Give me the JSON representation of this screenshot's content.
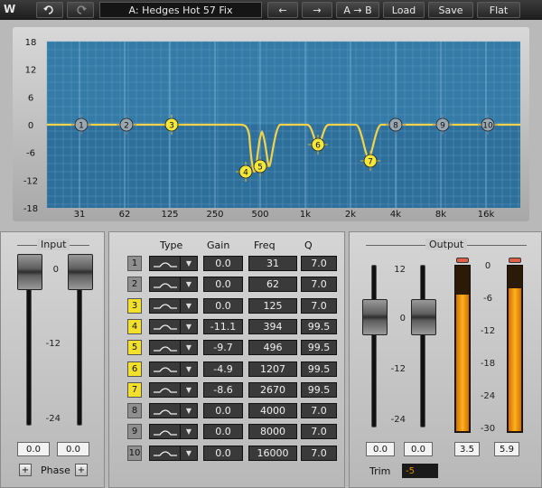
{
  "toolbar": {
    "undo_icon": "undo-icon",
    "redo_icon": "redo-icon",
    "preset_name": "A: Hedges Hot 57 Fix",
    "prev_icon": "arrow-left-icon",
    "next_icon": "arrow-right-icon",
    "ab_label": "A → B",
    "load_label": "Load",
    "save_label": "Save",
    "flat_label": "Flat"
  },
  "graph": {
    "y_labels": [
      "18",
      "12",
      "6",
      "0",
      "-6",
      "-12",
      "-18"
    ],
    "x_labels": [
      "31",
      "62",
      "125",
      "250",
      "500",
      "1k",
      "2k",
      "4k",
      "8k",
      "16k"
    ],
    "handles": [
      {
        "label": "1",
        "active": false
      },
      {
        "label": "2",
        "active": false
      },
      {
        "label": "3",
        "active": true
      },
      {
        "label": "4",
        "active": true
      },
      {
        "label": "5",
        "active": true
      },
      {
        "label": "6",
        "active": true
      },
      {
        "label": "7",
        "active": true
      },
      {
        "label": "8",
        "active": false
      },
      {
        "label": "9",
        "active": false
      },
      {
        "label": "10",
        "active": false
      }
    ],
    "curve_color": "#f2d34a",
    "bg_color": "#2e6e9a"
  },
  "input": {
    "title": "Input",
    "scale": [
      "0",
      "-12",
      "-24"
    ],
    "left_value": "0.0",
    "right_value": "0.0",
    "phase_label": "Phase",
    "plus_left": "+",
    "plus_right": "+"
  },
  "bands": {
    "headers": {
      "type": "Type",
      "gain": "Gain",
      "freq": "Freq",
      "q": "Q"
    },
    "rows": [
      {
        "num": "1",
        "on": false,
        "gain": "0.0",
        "freq": "31",
        "q": "7.0"
      },
      {
        "num": "2",
        "on": false,
        "gain": "0.0",
        "freq": "62",
        "q": "7.0"
      },
      {
        "num": "3",
        "on": true,
        "gain": "0.0",
        "freq": "125",
        "q": "7.0"
      },
      {
        "num": "4",
        "on": true,
        "gain": "-11.1",
        "freq": "394",
        "q": "99.5"
      },
      {
        "num": "5",
        "on": true,
        "gain": "-9.7",
        "freq": "496",
        "q": "99.5"
      },
      {
        "num": "6",
        "on": true,
        "gain": "-4.9",
        "freq": "1207",
        "q": "99.5"
      },
      {
        "num": "7",
        "on": true,
        "gain": "-8.6",
        "freq": "2670",
        "q": "99.5"
      },
      {
        "num": "8",
        "on": false,
        "gain": "0.0",
        "freq": "4000",
        "q": "7.0"
      },
      {
        "num": "9",
        "on": false,
        "gain": "0.0",
        "freq": "8000",
        "q": "7.0"
      },
      {
        "num": "10",
        "on": false,
        "gain": "0.0",
        "freq": "16000",
        "q": "7.0"
      }
    ]
  },
  "output": {
    "title": "Output",
    "fader_scale": [
      "12",
      "0",
      "-12",
      "-24"
    ],
    "meter_scale": [
      "0",
      "-6",
      "-12",
      "-18",
      "-24",
      "-30"
    ],
    "left_value": "0.0",
    "right_value": "0.0",
    "meter_left": "3.5",
    "meter_right": "5.9",
    "meter_left_level": 0.82,
    "meter_right_level": 0.86,
    "trim_label": "Trim",
    "trim_value": "-5"
  }
}
